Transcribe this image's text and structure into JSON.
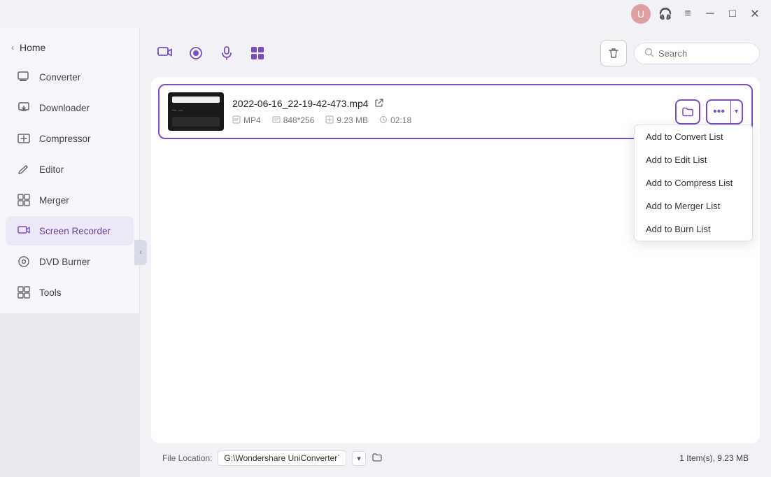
{
  "titlebar": {
    "avatar_color": "#d9837a",
    "avatar_label": "U",
    "headset_icon": "🎧",
    "menu_icon": "≡",
    "minimize_icon": "─",
    "maximize_icon": "□",
    "close_icon": "✕"
  },
  "sidebar": {
    "home_label": "Home",
    "collapse_icon": "‹",
    "items": [
      {
        "id": "converter",
        "label": "Converter",
        "icon": "🖵"
      },
      {
        "id": "downloader",
        "label": "Downloader",
        "icon": "📥"
      },
      {
        "id": "compressor",
        "label": "Compressor",
        "icon": "🎞"
      },
      {
        "id": "editor",
        "label": "Editor",
        "icon": "✂"
      },
      {
        "id": "merger",
        "label": "Merger",
        "icon": "⊞"
      },
      {
        "id": "screen-recorder",
        "label": "Screen Recorder",
        "icon": "⊡",
        "active": true
      },
      {
        "id": "dvd-burner",
        "label": "DVD Burner",
        "icon": "💿"
      },
      {
        "id": "tools",
        "label": "Tools",
        "icon": "⊞"
      }
    ]
  },
  "toolbar": {
    "icons": [
      {
        "id": "video-icon",
        "symbol": "▭"
      },
      {
        "id": "record-icon",
        "symbol": "⏺"
      },
      {
        "id": "mic-icon",
        "symbol": "🎙"
      },
      {
        "id": "grid-icon",
        "symbol": "⊞"
      }
    ],
    "trash_icon": "🗑",
    "search_placeholder": "Search"
  },
  "file": {
    "name": "2022-06-16_22-19-42-473.mp4",
    "open_icon": "⤢",
    "folder_icon": "📁",
    "format": "MP4",
    "resolution": "848*256",
    "size": "9.23 MB",
    "duration": "02:18"
  },
  "actions": {
    "folder_btn_icon": "📁",
    "more_dots": "•••",
    "more_chevron": "▾"
  },
  "dropdown": {
    "items": [
      "Add to Convert List",
      "Add to Edit List",
      "Add to Compress List",
      "Add to Merger List",
      "Add to Burn List"
    ]
  },
  "footer": {
    "label": "File Location:",
    "path": "G:\\Wondershare UniConverter`",
    "dropdown_icon": "▾",
    "folder_icon": "📁",
    "count": "1 Item(s), 9.23 MB"
  }
}
